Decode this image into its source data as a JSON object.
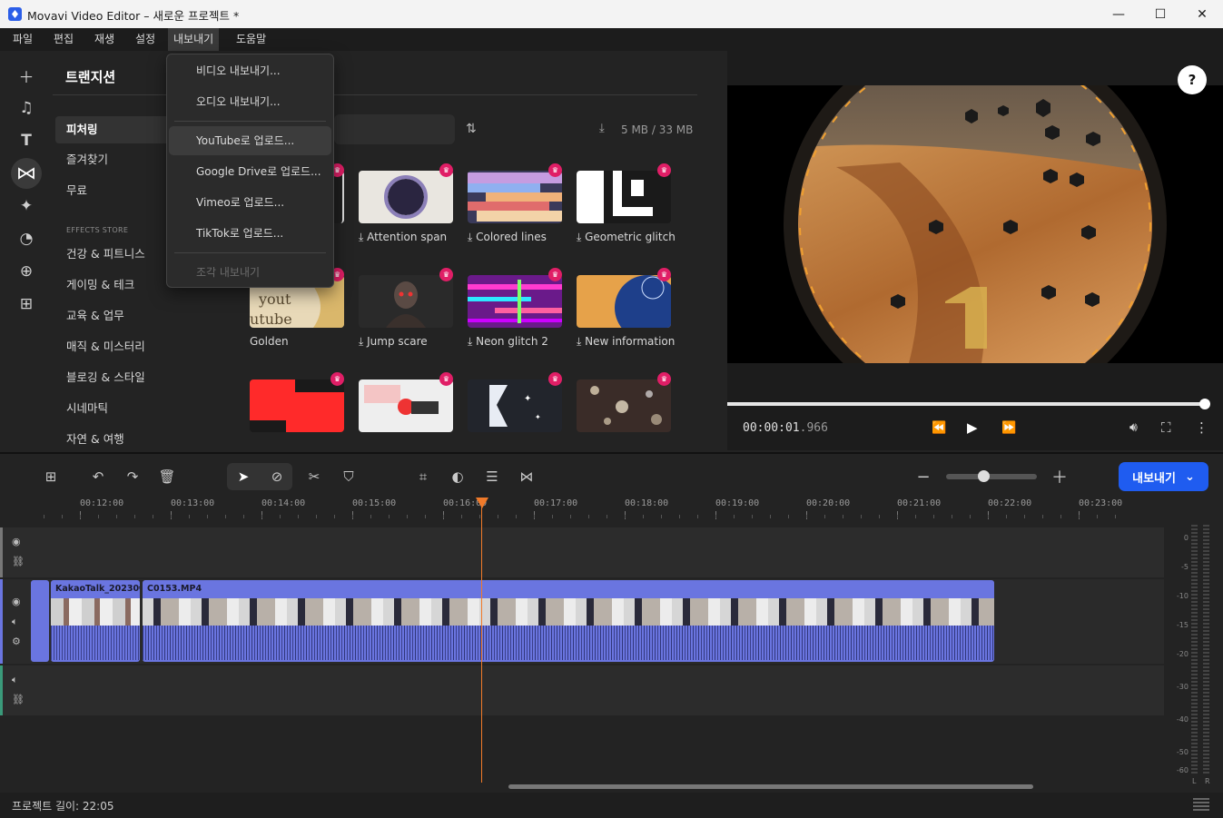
{
  "window": {
    "title": "Movavi Video Editor – 새로운 프로젝트 *",
    "minimize": "—",
    "maximize": "☐",
    "close": "✕"
  },
  "menu": [
    "파일",
    "편집",
    "재생",
    "설정",
    "내보내기",
    "도움말"
  ],
  "export_menu": {
    "items": [
      {
        "label": "비디오 내보내기..."
      },
      {
        "label": "오디오 내보내기..."
      },
      {
        "label": "YouTube로 업로드..."
      },
      {
        "label": "Google Drive로 업로드..."
      },
      {
        "label": "Vimeo로 업로드..."
      },
      {
        "label": "TikTok로 업로드..."
      },
      {
        "label": "조각 내보내기"
      }
    ]
  },
  "panel": {
    "title": "트랜지션",
    "storage": "5 MB / 33 MB",
    "categories": [
      "피처링",
      "즐겨찾기",
      "무료"
    ],
    "store_heading": "EFFECTS STORE",
    "store_categories": [
      "건강 & 피트니스",
      "게이밍 & 테크",
      "교육 & 업무",
      "매직 & 미스터리",
      "블로깅 & 스타일",
      "시네마틱",
      "자연 & 여행"
    ],
    "transitions": [
      {
        "label": "Attention span"
      },
      {
        "label": "Colored lines"
      },
      {
        "label": "Geometric glitch"
      },
      {
        "label": "Golden"
      },
      {
        "label": "Jump scare"
      },
      {
        "label": "Neon glitch 2"
      },
      {
        "label": "New information"
      }
    ]
  },
  "player": {
    "time": "00:00:01",
    "time_frac": ".966",
    "progress": 0.99
  },
  "timeline": {
    "export_button": "내보내기",
    "ticks": [
      "00:12:00",
      "00:13:00",
      "00:14:00",
      "00:15:00",
      "00:16:00",
      "00:17:00",
      "00:18:00",
      "00:19:00",
      "00:20:00",
      "00:21:00",
      "00:22:00",
      "00:23:00"
    ],
    "clips": [
      {
        "label": "KakaoTalk_20230€"
      },
      {
        "label": "C0153.MP4"
      }
    ],
    "meter_labels": [
      "0",
      "-5",
      "-10",
      "-15",
      "-20",
      "-30",
      "-40",
      "-50",
      "-60"
    ],
    "meter_channels": [
      "L",
      "R"
    ]
  },
  "status": {
    "project_length": "프로젝트 길이: 22:05"
  },
  "colors": {
    "accent": "#1f5cf0",
    "clip": "#6a75e0",
    "playhead": "#f07a2a",
    "crown": "#e01e66"
  }
}
